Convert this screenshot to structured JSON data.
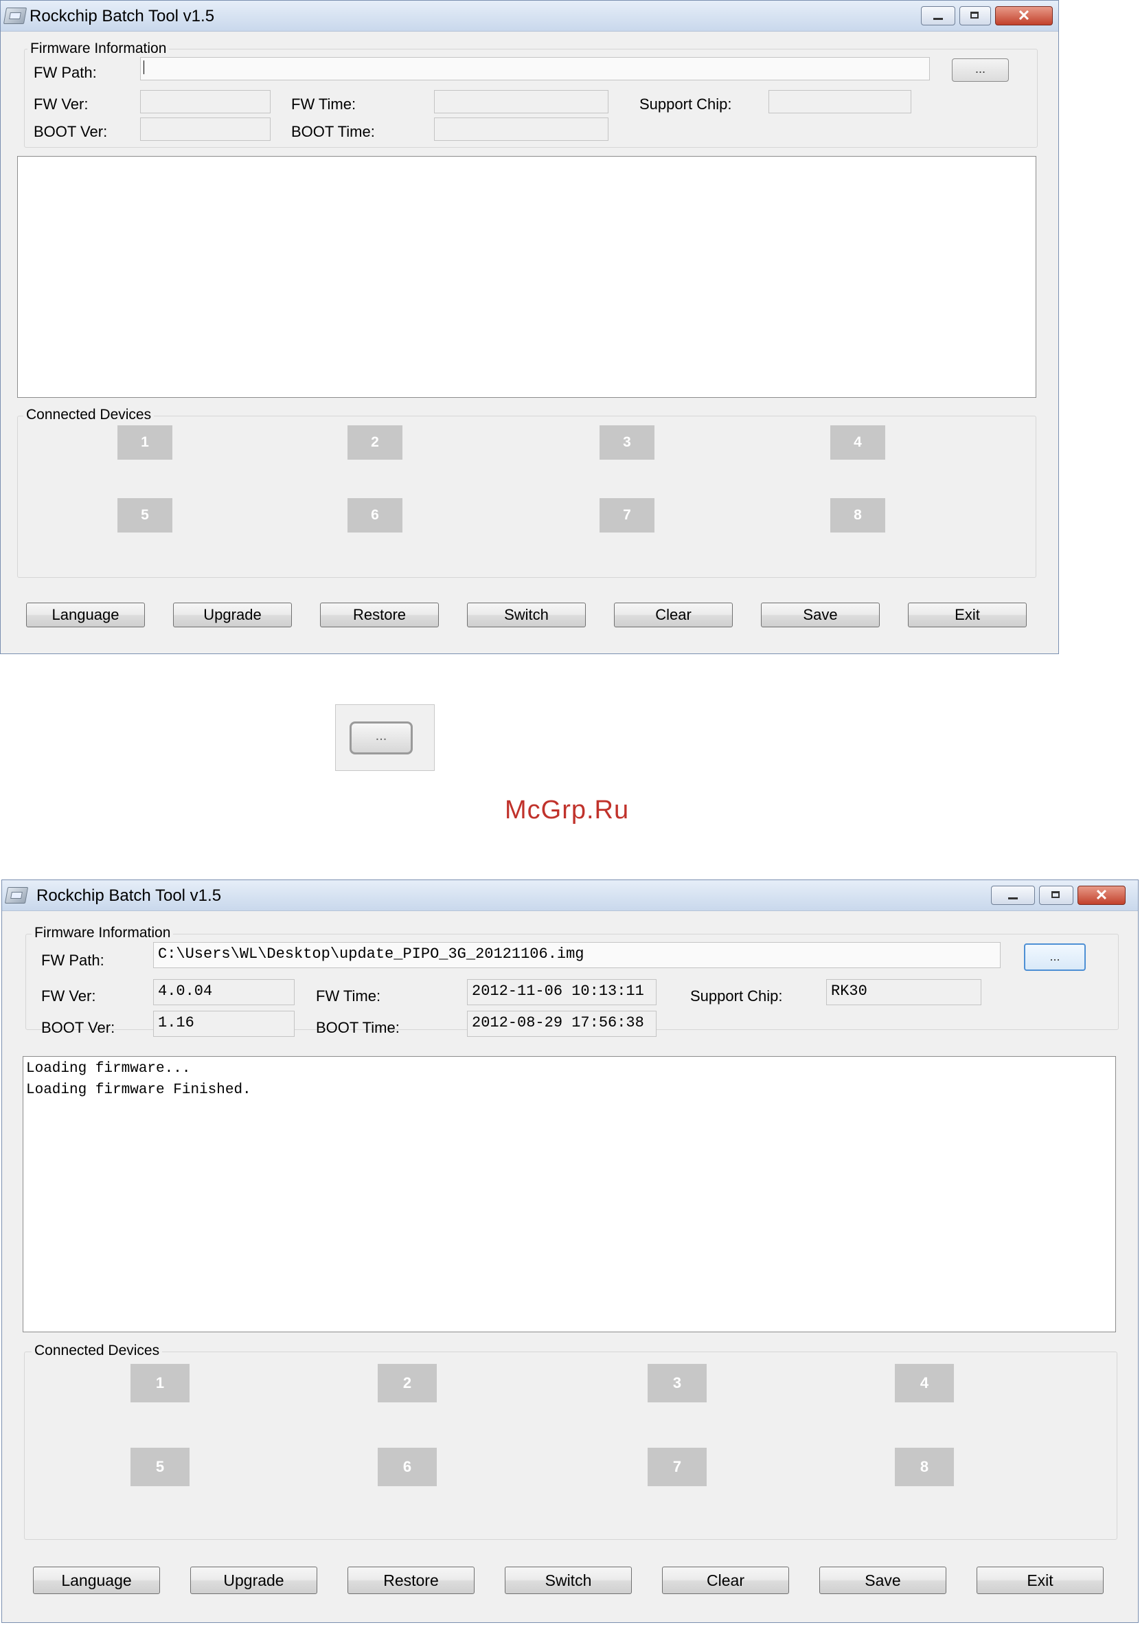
{
  "title": "Rockchip Batch Tool v1.5",
  "labels": {
    "firmware_info": "Firmware Information",
    "fw_path": "FW Path:",
    "fw_ver": "FW Ver:",
    "fw_time": "FW Time:",
    "support_chip": "Support Chip:",
    "boot_ver": "BOOT Ver:",
    "boot_time": "BOOT Time:",
    "connected_devices": "Connected Devices",
    "browse": "..."
  },
  "window_controls": {
    "close": "✕"
  },
  "devices": [
    "1",
    "2",
    "3",
    "4",
    "5",
    "6",
    "7",
    "8"
  ],
  "buttons": {
    "language": "Language",
    "upgrade": "Upgrade",
    "restore": "Restore",
    "switch": "Switch",
    "clear": "Clear",
    "save": "Save",
    "exit": "Exit"
  },
  "loaded": {
    "fw_path": "C:\\Users\\WL\\Desktop\\update_PIPO_3G_20121106.img",
    "fw_ver": "4.0.04",
    "fw_time": "2012-11-06 10:13:11",
    "support_chip": "RK30",
    "boot_ver": "1.16",
    "boot_time": "2012-08-29 17:56:38",
    "log": [
      "Loading firmware...",
      "Loading firmware Finished."
    ]
  },
  "zoom": {
    "label": "..."
  },
  "watermark": "McGrp.Ru",
  "colors": {
    "device_tile": "#c7c7c7",
    "close_button": "#c2412c",
    "watermark": "#c0322b"
  }
}
